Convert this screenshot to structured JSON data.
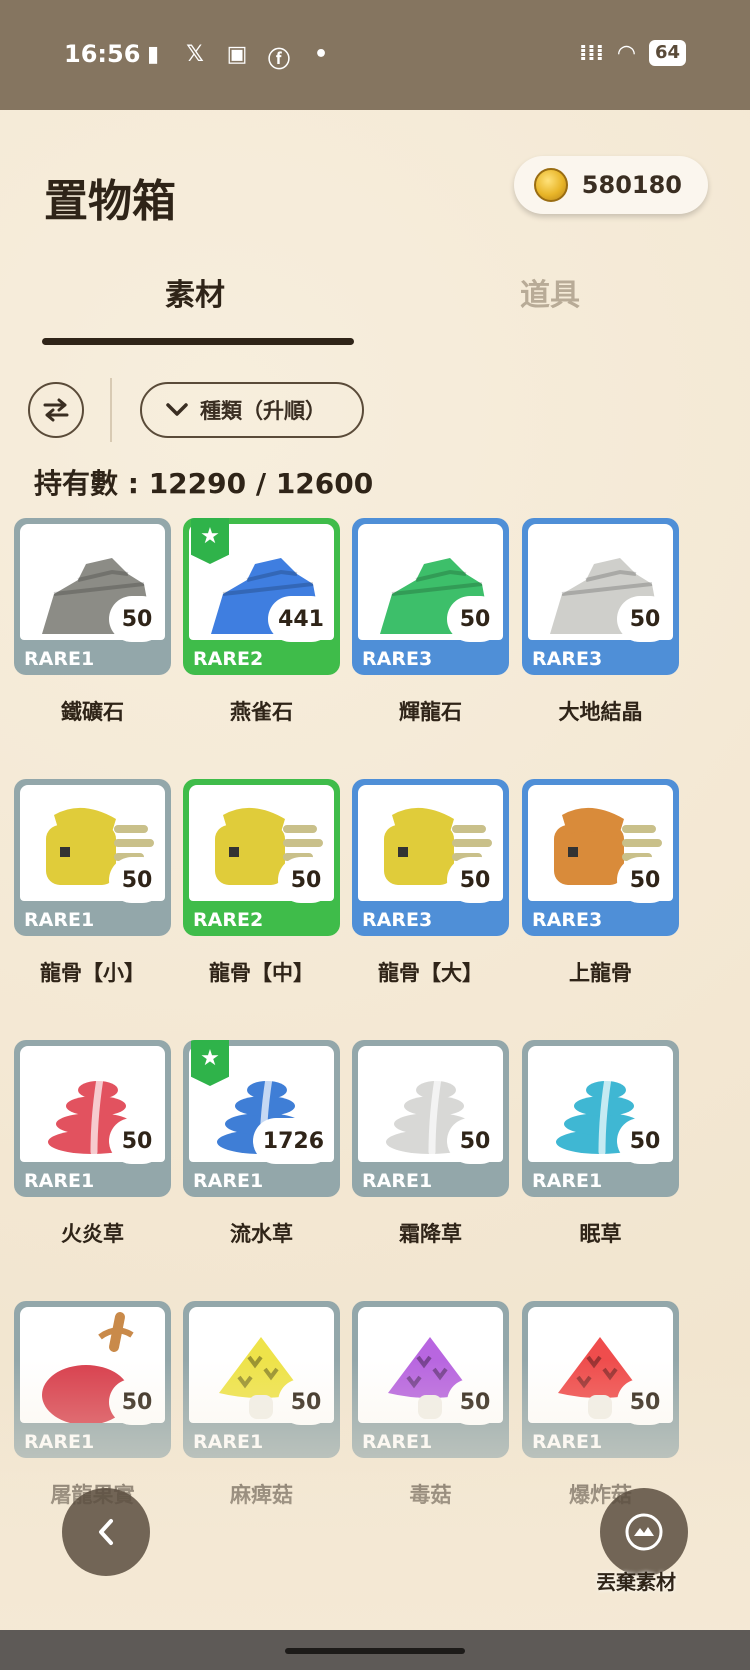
{
  "status_bar": {
    "time": "16:56",
    "battery": "64"
  },
  "header": {
    "title": "置物箱",
    "coins": "580180"
  },
  "tabs": [
    {
      "label": "素材",
      "active": true
    },
    {
      "label": "道具",
      "active": false
    }
  ],
  "controls": {
    "sort_label": "種類（升順）"
  },
  "inventory": {
    "count_label": "持有數 : 12290 / 12600"
  },
  "items": [
    {
      "name": "鐵礦石",
      "rarity": "RARE1",
      "qty": "50",
      "color": "#93a7aa",
      "starred": false,
      "icon": "ore-icon",
      "tint": "#8c8c86"
    },
    {
      "name": "燕雀石",
      "rarity": "RARE2",
      "qty": "441",
      "color": "#3fbc4a",
      "starred": true,
      "icon": "ore-icon",
      "tint": "#3f7ee0"
    },
    {
      "name": "輝龍石",
      "rarity": "RARE3",
      "qty": "50",
      "color": "#4f8fd7",
      "starred": false,
      "icon": "ore-icon",
      "tint": "#3dbf6a"
    },
    {
      "name": "大地結晶",
      "rarity": "RARE3",
      "qty": "50",
      "color": "#4f8fd7",
      "starred": false,
      "icon": "ore-icon",
      "tint": "#cfcfcb"
    },
    {
      "name": "龍骨【小】",
      "rarity": "RARE1",
      "qty": "50",
      "color": "#93a7aa",
      "starred": false,
      "icon": "bone-icon",
      "tint": "#e0cc3a"
    },
    {
      "name": "龍骨【中】",
      "rarity": "RARE2",
      "qty": "50",
      "color": "#3fbc4a",
      "starred": false,
      "icon": "bone-icon",
      "tint": "#e0cc3a"
    },
    {
      "name": "龍骨【大】",
      "rarity": "RARE3",
      "qty": "50",
      "color": "#4f8fd7",
      "starred": false,
      "icon": "bone-icon",
      "tint": "#e0cc3a"
    },
    {
      "name": "上龍骨",
      "rarity": "RARE3",
      "qty": "50",
      "color": "#4f8fd7",
      "starred": false,
      "icon": "bone-icon",
      "tint": "#d98b3a"
    },
    {
      "name": "火炎草",
      "rarity": "RARE1",
      "qty": "50",
      "color": "#93a7aa",
      "starred": false,
      "icon": "herb-icon",
      "tint": "#e2525f"
    },
    {
      "name": "流水草",
      "rarity": "RARE1",
      "qty": "1726",
      "color": "#93a7aa",
      "starred": true,
      "icon": "herb-icon",
      "tint": "#3f7ed6"
    },
    {
      "name": "霜降草",
      "rarity": "RARE1",
      "qty": "50",
      "color": "#93a7aa",
      "starred": false,
      "icon": "herb-icon",
      "tint": "#d8d8d6"
    },
    {
      "name": "眠草",
      "rarity": "RARE1",
      "qty": "50",
      "color": "#93a7aa",
      "starred": false,
      "icon": "herb-icon",
      "tint": "#3fb7d3"
    },
    {
      "name": "屠龍果實",
      "rarity": "RARE1",
      "qty": "50",
      "color": "#93a7aa",
      "starred": false,
      "icon": "fruit-icon",
      "tint": "#d8404e"
    },
    {
      "name": "麻痺菇",
      "rarity": "RARE1",
      "qty": "50",
      "color": "#93a7aa",
      "starred": false,
      "icon": "mushroom-icon",
      "tint": "#eee34a"
    },
    {
      "name": "毒菇",
      "rarity": "RARE1",
      "qty": "50",
      "color": "#93a7aa",
      "starred": false,
      "icon": "mushroom-icon",
      "tint": "#b866e0"
    },
    {
      "name": "爆炸菇",
      "rarity": "RARE1",
      "qty": "50",
      "color": "#93a7aa",
      "starred": false,
      "icon": "mushroom-icon",
      "tint": "#ef4d4d"
    }
  ],
  "footer": {
    "back_icon": "chevron-left-icon",
    "discard_label": "丟棄素材"
  }
}
